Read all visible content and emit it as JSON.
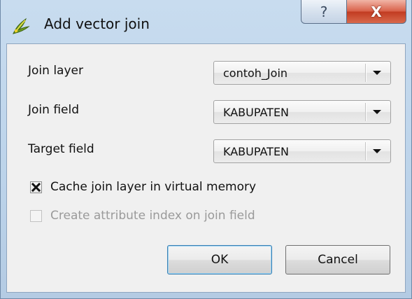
{
  "window": {
    "title": "Add vector join",
    "icon": "qgis-icon",
    "help_label": "?",
    "close_label": "X"
  },
  "form": {
    "join_layer": {
      "label": "Join layer",
      "value": "contoh_Join"
    },
    "join_field": {
      "label": "Join field",
      "value": "KABUPATEN"
    },
    "target_field": {
      "label": "Target field",
      "value": "KABUPATEN"
    }
  },
  "options": {
    "cache": {
      "label": "Cache join layer in virtual memory",
      "checked": true,
      "enabled": true
    },
    "index": {
      "label": "Create attribute index on join field",
      "checked": false,
      "enabled": false
    }
  },
  "buttons": {
    "ok": "OK",
    "cancel": "Cancel"
  }
}
